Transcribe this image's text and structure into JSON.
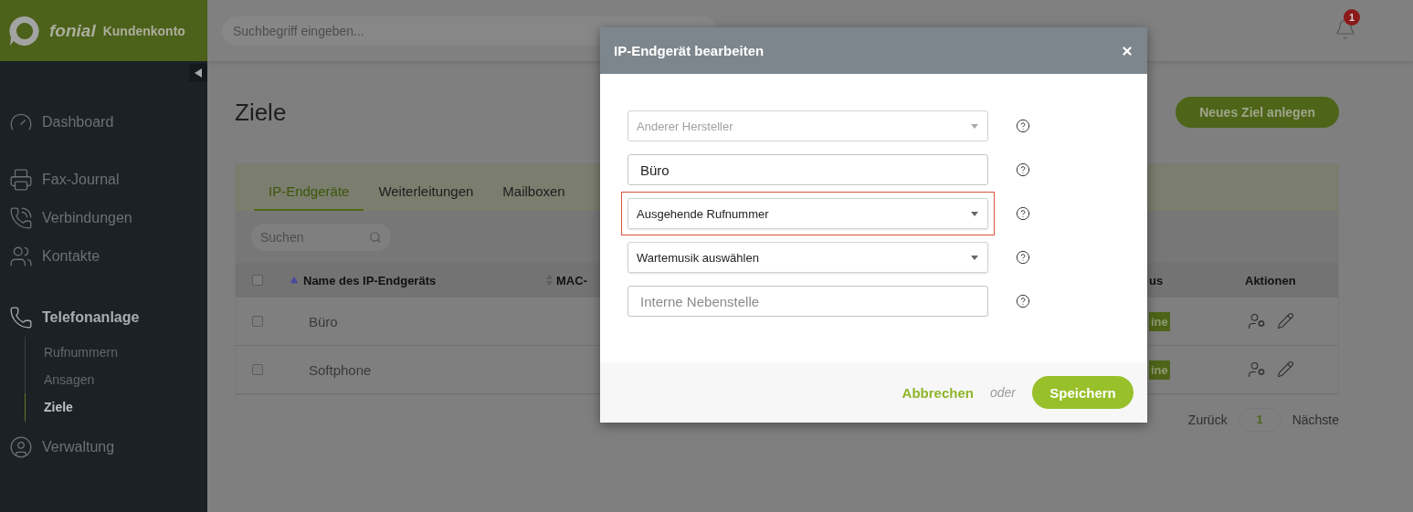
{
  "brand": {
    "name": "fonial",
    "product": "Kundenkonto"
  },
  "search": {
    "placeholder": "Suchbegriff eingeben..."
  },
  "notifications": {
    "count": "1"
  },
  "sidebar": {
    "items": [
      {
        "label": "Dashboard",
        "selected": false
      },
      {
        "label": "Fax-Journal",
        "selected": false
      },
      {
        "label": "Verbindungen",
        "selected": false
      },
      {
        "label": "Kontakte",
        "selected": false
      },
      {
        "label": "Telefonanlage",
        "selected": true,
        "children": [
          {
            "label": "Rufnummern",
            "selected": false
          },
          {
            "label": "Ansagen",
            "selected": false
          },
          {
            "label": "Ziele",
            "selected": true
          }
        ]
      },
      {
        "label": "Verwaltung",
        "selected": false
      }
    ]
  },
  "page": {
    "title": "Ziele",
    "primary_button": "Neues Ziel anlegen"
  },
  "tabs": [
    {
      "label": "IP-Endgeräte",
      "selected": true
    },
    {
      "label": "Weiterleitungen",
      "selected": false
    },
    {
      "label": "Mailboxen",
      "selected": false
    }
  ],
  "table_search": {
    "placeholder": "Suchen"
  },
  "table": {
    "all_checked": false,
    "columns": [
      "Name des IP-Endgeräts",
      "MAC-",
      "us",
      "Aktionen"
    ],
    "rows": [
      {
        "checked": false,
        "name": "Büro",
        "status": "ine"
      },
      {
        "checked": false,
        "name": "Softphone",
        "status": "ine"
      }
    ]
  },
  "pagination": {
    "previous": "Zurück",
    "page": "1",
    "next": "Nächste"
  },
  "dialog": {
    "title": "IP-Endgerät bearbeiten",
    "fields": [
      {
        "kind": "select",
        "value": "Anderer Hersteller",
        "disabled": true,
        "highlighted": false
      },
      {
        "kind": "input",
        "value": "Büro",
        "disabled": false,
        "highlighted": false
      },
      {
        "kind": "select",
        "value": "Ausgehende Rufnummer",
        "disabled": false,
        "highlighted": true
      },
      {
        "kind": "select",
        "value": "Wartemusik auswählen",
        "disabled": false,
        "highlighted": false
      },
      {
        "kind": "input",
        "placeholder": "Interne Nebenstelle",
        "disabled": false,
        "highlighted": false
      }
    ],
    "cancel": "Abbrechen",
    "separator": "oder",
    "save": "Speichern"
  }
}
